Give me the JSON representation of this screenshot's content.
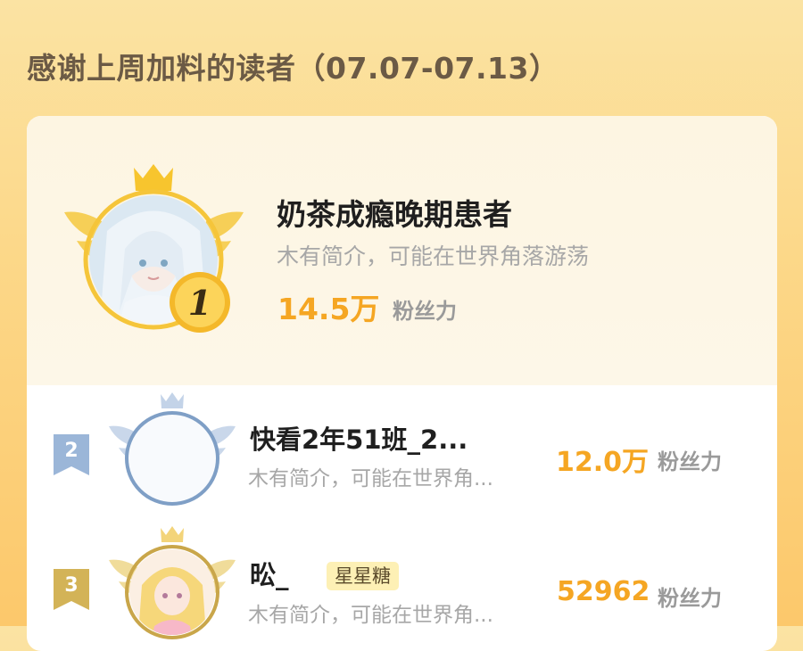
{
  "title": "感谢上周加料的读者（07.07-07.13）",
  "colors": {
    "accent": "#f5a623",
    "page_background": "#fcd889",
    "card_highlight": "#fdf5e2",
    "silver": "#7f9fc6",
    "bronze": "#d7b85a"
  },
  "leaderboard": [
    {
      "rank": "1",
      "name": "奶茶成瘾晚期患者",
      "bio": "木有简介，可能在世界角落游荡",
      "fans_value": "14.5万",
      "fans_unit": "粉丝力",
      "frame_icon": "gold-crown-wings-icon"
    },
    {
      "rank": "2",
      "name": "快看2年51班_2...",
      "bio": "木有简介，可能在世界角...",
      "fans_value": "12.0万",
      "fans_unit": "粉丝力",
      "frame_icon": "silver-crown-wings-icon"
    },
    {
      "rank": "3",
      "name": "昖_",
      "badge": "星星糖",
      "bio": "木有简介，可能在世界角...",
      "fans_value": "52962",
      "fans_unit": "粉丝力",
      "frame_icon": "bronze-crown-wings-icon"
    }
  ]
}
